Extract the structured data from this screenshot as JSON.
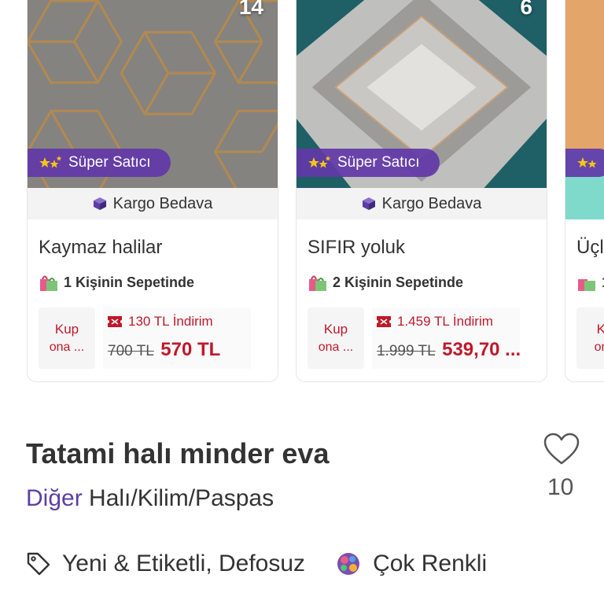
{
  "cards": [
    {
      "count": "14",
      "seller_badge": "Süper Satıcı",
      "shipping": "Kargo Bedava",
      "title": "Kaymaz halilar",
      "basket": "1 Kişinin Sepetinde",
      "coupon_line1": "Kup",
      "coupon_line2": "ona ...",
      "discount": "130 TL İndirim",
      "old_price": "700 TL",
      "new_price": "570 TL"
    },
    {
      "count": "6",
      "seller_badge": "Süper Satıcı",
      "shipping": "Kargo Bedava",
      "title": "SIFIR yoluk",
      "basket": "2 Kişinin Sepetinde",
      "coupon_line1": "Kup",
      "coupon_line2": "ona ...",
      "discount": "1.459 TL İndirim",
      "old_price": "1.999 TL",
      "new_price": "539,70 ..."
    },
    {
      "count": "",
      "seller_badge": "",
      "shipping": "",
      "title": "Üçl",
      "basket": "1",
      "coupon_line1": "Ku",
      "coupon_line2": "ona",
      "discount": "",
      "old_price": "",
      "new_price": ""
    }
  ],
  "product": {
    "title": "Tatami halı minder eva",
    "category_link": "Diğer",
    "category_rest": " Halı/Kilim/Paspas",
    "favorites": "10",
    "condition": "Yeni & Etiketli, Defosuz",
    "color": "Çok Renkli"
  },
  "colors": {
    "accent_purple": "#5b3ea6",
    "price_red": "#c0182a",
    "badge_purple": "#6238a8"
  },
  "icons": [
    "stars-icon",
    "box-icon",
    "shopping-bag-icon",
    "ticket-icon",
    "heart-icon",
    "tag-icon",
    "multicolor-icon"
  ]
}
